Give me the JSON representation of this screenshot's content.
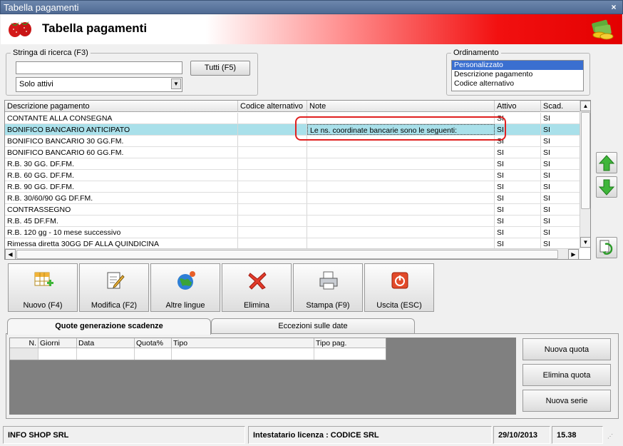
{
  "window": {
    "title": "Tabella pagamenti",
    "close": "×"
  },
  "banner": {
    "title": "Tabella pagamenti"
  },
  "search": {
    "legend": "Stringa di ricerca (F3)",
    "value": "",
    "all_button": "Tutti (F5)",
    "filter_selected": "Solo attivi"
  },
  "sort": {
    "legend": "Ordinamento",
    "options": [
      "Personalizzato",
      "Descrizione pagamento",
      "Codice alternativo"
    ],
    "selected": "Personalizzato"
  },
  "grid": {
    "columns": [
      "Descrizione pagamento",
      "Codice alternativo",
      "Note",
      "Attivo",
      "Scad."
    ],
    "rows": [
      {
        "desc": "CONTANTE ALLA CONSEGNA",
        "code": "",
        "note": "",
        "active": "SI",
        "scad": "SI"
      },
      {
        "desc": "BONIFICO BANCARIO ANTICIPATO",
        "code": "",
        "note": "Le ns. coordinate bancarie sono le seguenti:",
        "active": "SI",
        "scad": "SI"
      },
      {
        "desc": "BONIFICO BANCARIO 30 GG.FM.",
        "code": "",
        "note": "",
        "active": "SI",
        "scad": "SI"
      },
      {
        "desc": "BONIFICO BANCARIO 60 GG.FM.",
        "code": "",
        "note": "",
        "active": "SI",
        "scad": "SI"
      },
      {
        "desc": "R.B. 30 GG. DF.FM.",
        "code": "",
        "note": "",
        "active": "SI",
        "scad": "SI"
      },
      {
        "desc": "R.B. 60 GG. DF.FM.",
        "code": "",
        "note": "",
        "active": "SI",
        "scad": "SI"
      },
      {
        "desc": "R.B. 90 GG. DF.FM.",
        "code": "",
        "note": "",
        "active": "SI",
        "scad": "SI"
      },
      {
        "desc": "R.B. 30/60/90 GG DF.FM.",
        "code": "",
        "note": "",
        "active": "SI",
        "scad": "SI"
      },
      {
        "desc": "CONTRASSEGNO",
        "code": "",
        "note": "",
        "active": "SI",
        "scad": "SI"
      },
      {
        "desc": "R.B. 45 DF.FM.",
        "code": "",
        "note": "",
        "active": "SI",
        "scad": "SI"
      },
      {
        "desc": "R.B. 120 gg - 10 mese successivo",
        "code": "",
        "note": "",
        "active": "SI",
        "scad": "SI"
      },
      {
        "desc": "Rimessa diretta 30GG DF ALLA QUINDICINA",
        "code": "",
        "note": "",
        "active": "SI",
        "scad": "SI"
      }
    ],
    "selected_row_index": 1
  },
  "toolbar": {
    "new": "Nuovo (F4)",
    "edit": "Modifica (F2)",
    "languages": "Altre lingue",
    "delete": "Elimina",
    "print": "Stampa (F9)",
    "exit": "Uscita (ESC)"
  },
  "tabs": {
    "quote": "Quote generazione scadenze",
    "exceptions": "Eccezioni sulle date"
  },
  "subgrid": {
    "columns": [
      "N.",
      "Giorni",
      "Data",
      "Quota%",
      "Tipo",
      "Tipo pag."
    ]
  },
  "side_buttons": {
    "new_quota": "Nuova quota",
    "delete_quota": "Elimina quota",
    "new_series": "Nuova serie"
  },
  "status": {
    "company": "INFO SHOP SRL",
    "license": "Intestatario licenza : CODICE SRL",
    "date": "29/10/2013",
    "time": "15.38"
  },
  "colors": {
    "selected_row": "#a9e0ea",
    "banner_red": "#e30000",
    "highlight": "#e0201f",
    "list_selection": "#3a6fd0"
  }
}
